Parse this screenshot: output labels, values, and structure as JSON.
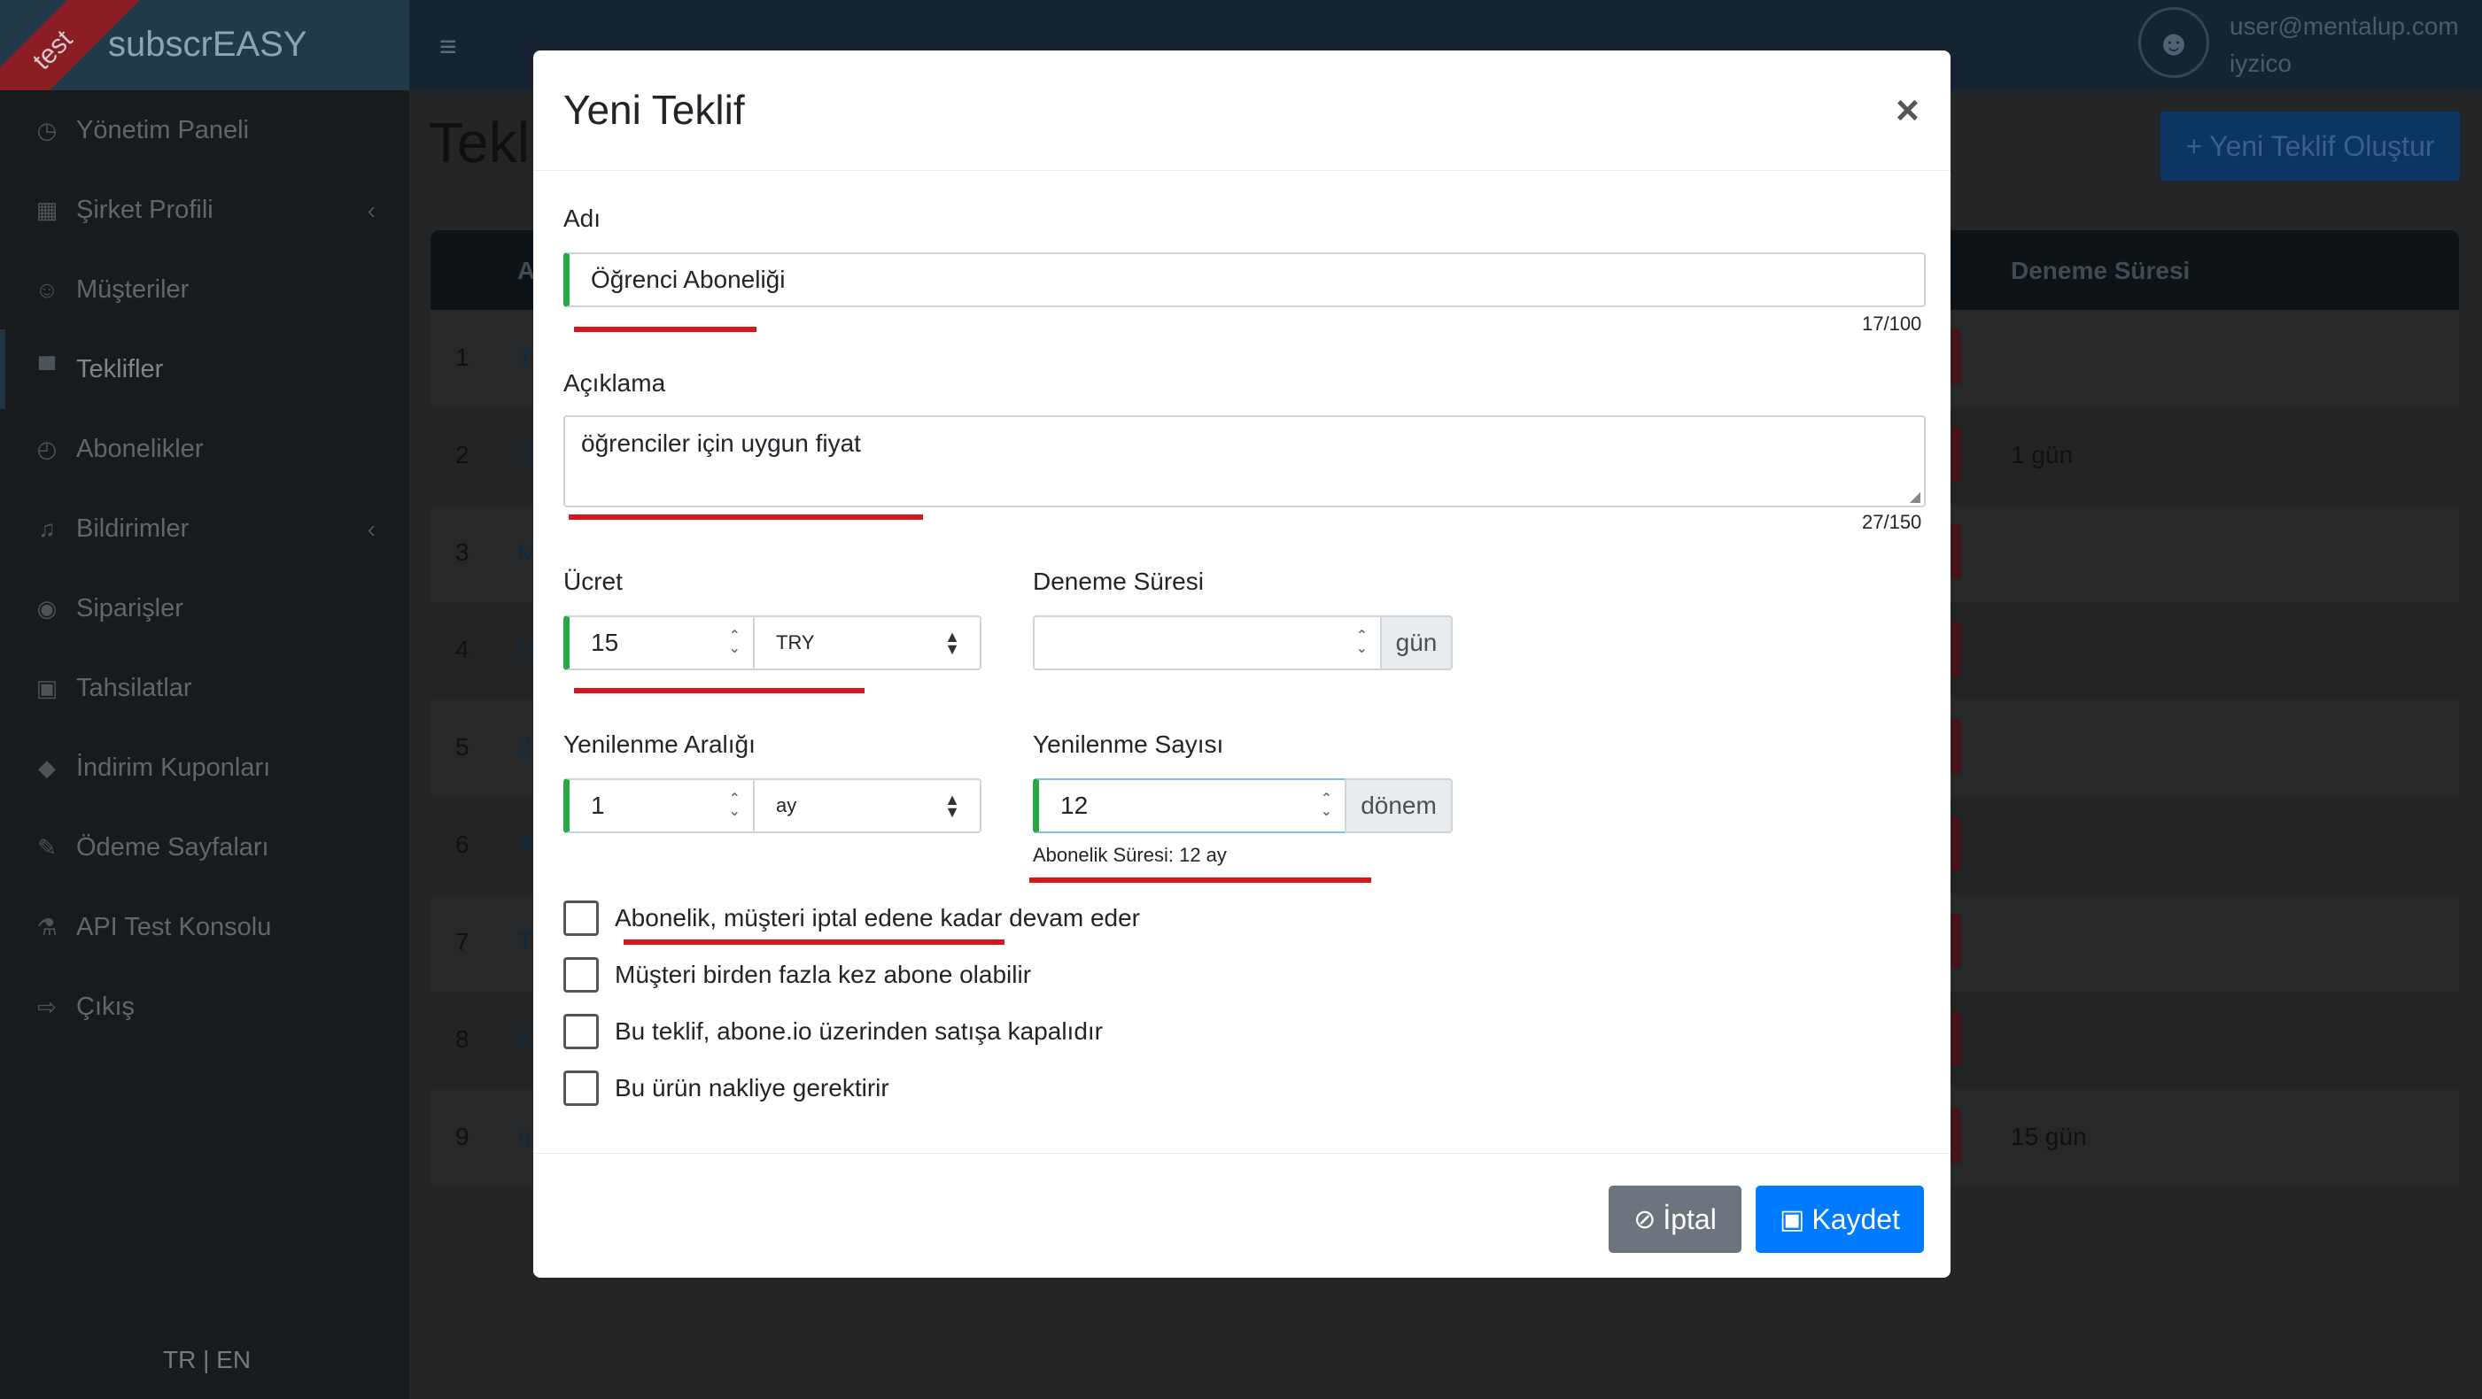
{
  "brand": {
    "name": "subscrEASY",
    "env_badge": "test"
  },
  "sidebar": {
    "items": [
      {
        "label": "Yönetim Paneli",
        "icon": "dashboard-icon",
        "glyph": "◷"
      },
      {
        "label": "Şirket Profili",
        "icon": "building-icon",
        "glyph": "▦",
        "chevron": "‹"
      },
      {
        "label": "Müşteriler",
        "icon": "smile-icon",
        "glyph": "☺"
      },
      {
        "label": "Teklifler",
        "icon": "cart-icon",
        "glyph": "▀"
      },
      {
        "label": "Abonelikler",
        "icon": "clock-icon",
        "glyph": "◴"
      },
      {
        "label": "Bildirimler",
        "icon": "bell-icon",
        "glyph": "♫",
        "chevron": "‹"
      },
      {
        "label": "Siparişler",
        "icon": "order-icon",
        "glyph": "◉"
      },
      {
        "label": "Tahsilatlar",
        "icon": "money-icon",
        "glyph": "▣"
      },
      {
        "label": "İndirim Kuponları",
        "icon": "tag-icon",
        "glyph": "◆"
      },
      {
        "label": "Ödeme Sayfaları",
        "icon": "wand-icon",
        "glyph": "✎"
      },
      {
        "label": "API Test Konsolu",
        "icon": "flask-icon",
        "glyph": "⚗"
      },
      {
        "label": "Çıkış",
        "icon": "sign-out-icon",
        "glyph": "⇨"
      }
    ],
    "lang": "TR | EN"
  },
  "topbar": {
    "hamburger": "≡",
    "user_email": "user@mentalup.com",
    "company": "iyzico",
    "avatar": "☻"
  },
  "page": {
    "title": "Teklifler",
    "new_button": "Yeni Teklif Oluştur",
    "table": {
      "col_a": "A",
      "col_trial": "Deneme Süresi",
      "rows": [
        {
          "num": "1",
          "name": "T",
          "trial": ""
        },
        {
          "num": "2",
          "name": "T",
          "trial": "1 gün"
        },
        {
          "num": "3",
          "name": "M",
          "trial": ""
        },
        {
          "num": "4",
          "name": "H",
          "trial": ""
        },
        {
          "num": "5",
          "name": "2",
          "trial": ""
        },
        {
          "num": "6",
          "name": "4",
          "trial": ""
        },
        {
          "num": "7",
          "name": "T",
          "trial": ""
        },
        {
          "num": "8",
          "name": "K",
          "trial": ""
        },
        {
          "num": "9",
          "name": "n",
          "trial": "15 gün"
        }
      ]
    }
  },
  "modal": {
    "title": "Yeni Teklif",
    "close": "×",
    "name_label": "Adı",
    "name_value": "Öğrenci Aboneliği",
    "name_counter": "17/100",
    "desc_label": "Açıklama",
    "desc_value": "öğrenciler için uygun fiyat",
    "desc_counter": "27/150",
    "price_label": "Ücret",
    "price_value": "15",
    "currency": "TRY",
    "trial_label": "Deneme Süresi",
    "trial_value": "",
    "trial_unit": "gün",
    "interval_label": "Yenilenme Aralığı",
    "interval_value": "1",
    "interval_unit": "ay",
    "count_label": "Yenilenme Sayısı",
    "count_value": "12",
    "count_unit": "dönem",
    "duration_help": "Abonelik Süresi: 12 ay",
    "checks": [
      "Abonelik, müşteri iptal edene kadar devam eder",
      "Müşteri birden fazla kez abone olabilir",
      "Bu teklif, abone.io üzerinden satışa kapalıdır",
      "Bu ürün nakliye gerektirir"
    ],
    "cancel": "İptal",
    "save": "Kaydet"
  }
}
